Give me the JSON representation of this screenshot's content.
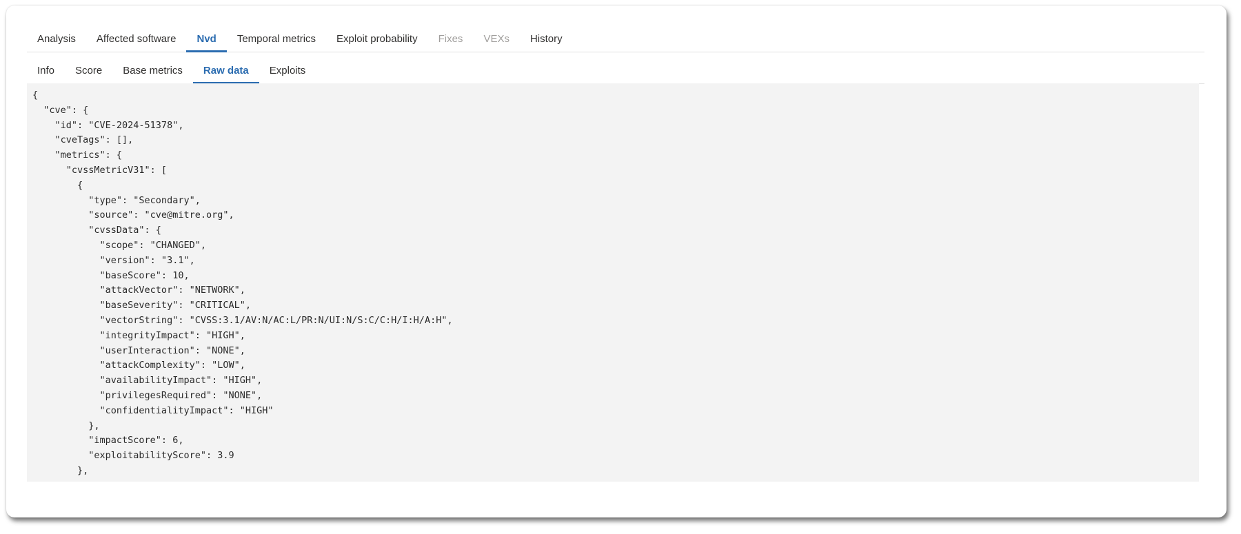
{
  "primary_tabs": [
    {
      "label": "Analysis"
    },
    {
      "label": "Affected software"
    },
    {
      "label": "Nvd"
    },
    {
      "label": "Temporal metrics"
    },
    {
      "label": "Exploit probability"
    },
    {
      "label": "Fixes"
    },
    {
      "label": "VEXs"
    },
    {
      "label": "History"
    }
  ],
  "primary_active": "Nvd",
  "secondary_tabs": [
    {
      "label": "Info"
    },
    {
      "label": "Score"
    },
    {
      "label": "Base metrics"
    },
    {
      "label": "Raw data"
    },
    {
      "label": "Exploits"
    }
  ],
  "secondary_active": "Raw data",
  "accent_color": "#2b6cb0",
  "raw_data": "{\n  \"cve\": {\n    \"id\": \"CVE-2024-51378\",\n    \"cveTags\": [],\n    \"metrics\": {\n      \"cvssMetricV31\": [\n        {\n          \"type\": \"Secondary\",\n          \"source\": \"cve@mitre.org\",\n          \"cvssData\": {\n            \"scope\": \"CHANGED\",\n            \"version\": \"3.1\",\n            \"baseScore\": 10,\n            \"attackVector\": \"NETWORK\",\n            \"baseSeverity\": \"CRITICAL\",\n            \"vectorString\": \"CVSS:3.1/AV:N/AC:L/PR:N/UI:N/S:C/C:H/I:H/A:H\",\n            \"integrityImpact\": \"HIGH\",\n            \"userInteraction\": \"NONE\",\n            \"attackComplexity\": \"LOW\",\n            \"availabilityImpact\": \"HIGH\",\n            \"privilegesRequired\": \"NONE\",\n            \"confidentialityImpact\": \"HIGH\"\n          },\n          \"impactScore\": 6,\n          \"exploitabilityScore\": 3.9\n        },"
}
